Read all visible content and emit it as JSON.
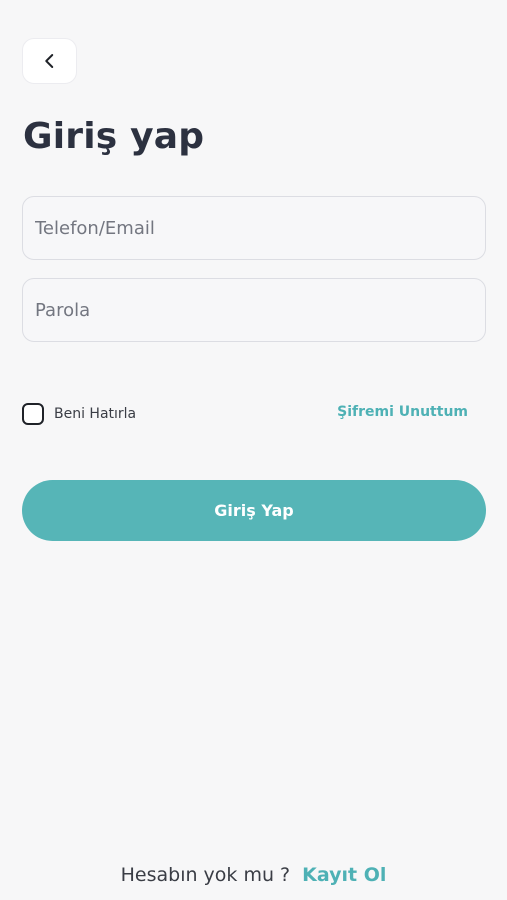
{
  "header": {
    "back_icon": "chevron-left-icon",
    "title": "Giriş yap"
  },
  "form": {
    "email_placeholder": "Telefon/Email",
    "email_value": "",
    "password_placeholder": "Parola",
    "password_value": "",
    "remember_label": "Beni Hatırla",
    "remember_checked": false,
    "forgot_label": "Şifremi Unuttum",
    "submit_label": "Giriş Yap"
  },
  "footer": {
    "question": "Hesabın yok mu ?",
    "signup_label": "Kayıt Ol"
  },
  "colors": {
    "accent": "#56b5b7",
    "link": "#4eb1b5",
    "background": "#f7f7f8",
    "title": "#2c3140"
  }
}
